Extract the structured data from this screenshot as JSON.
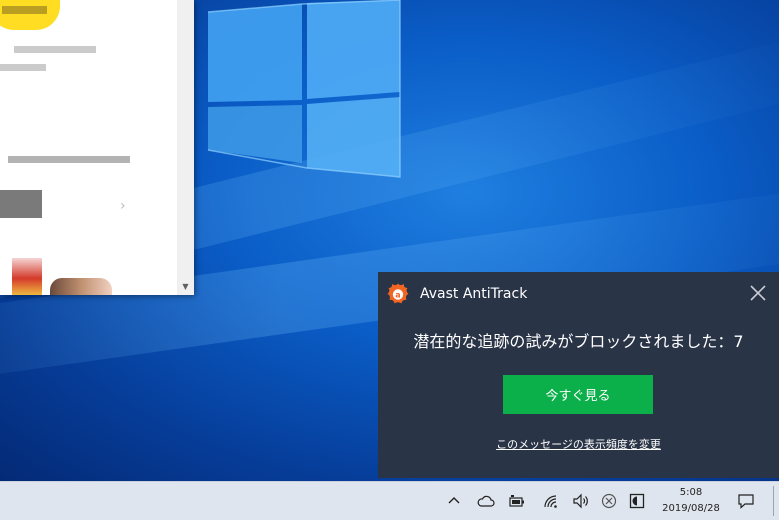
{
  "notification": {
    "app_name": "Avast AntiTrack",
    "message": "潜在的な追跡の試みがブロックされました：7",
    "button_label": "今すぐ見る",
    "link_label": "このメッセージの表示頻度を変更",
    "accent_color": "#0cb04a",
    "brand_color": "#f26522",
    "background_color": "#2a3447"
  },
  "taskbar": {
    "time": "5:08",
    "date": "2019/08/28",
    "tray_icons": [
      "chevron-up-icon",
      "onedrive-cloud-icon",
      "battery-icon",
      "wifi-icon",
      "volume-icon",
      "blocked-icon",
      "antitrack-tray-icon"
    ],
    "background_color": "#dfe5ee"
  },
  "desktop": {
    "background_color": "#0a5cc6"
  }
}
